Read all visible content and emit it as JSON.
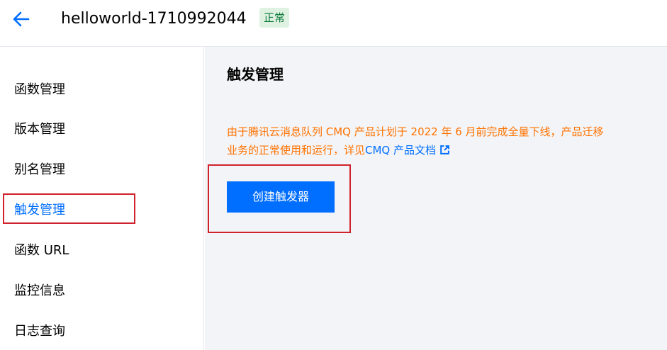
{
  "header": {
    "back_icon": "arrow-left-icon",
    "function_name": "helloworld-1710992044",
    "status": "正常",
    "status_color": "#0a7a3a",
    "status_bg": "#dff2e2"
  },
  "sidebar": {
    "items": [
      {
        "label": "函数管理"
      },
      {
        "label": "版本管理"
      },
      {
        "label": "别名管理"
      },
      {
        "label": "触发管理",
        "active": true
      },
      {
        "label": "函数 URL"
      },
      {
        "label": "监控信息"
      },
      {
        "label": "日志查询"
      }
    ],
    "active_color": "#006eff"
  },
  "main": {
    "title": "触发管理",
    "notice_line1": "由于腾讯云消息队列 CMQ 产品计划于 2022 年 6 月前完成全量下线，产品迁移",
    "notice_line2_prefix": "业务的正常使用和运行，详见",
    "notice_link": "CMQ 产品文档",
    "notice_link_icon": "external-link-icon",
    "notice_color": "#ff7200",
    "create_button": "创建触发器",
    "accent": "#006eff",
    "highlight_color": "#d0222c"
  }
}
